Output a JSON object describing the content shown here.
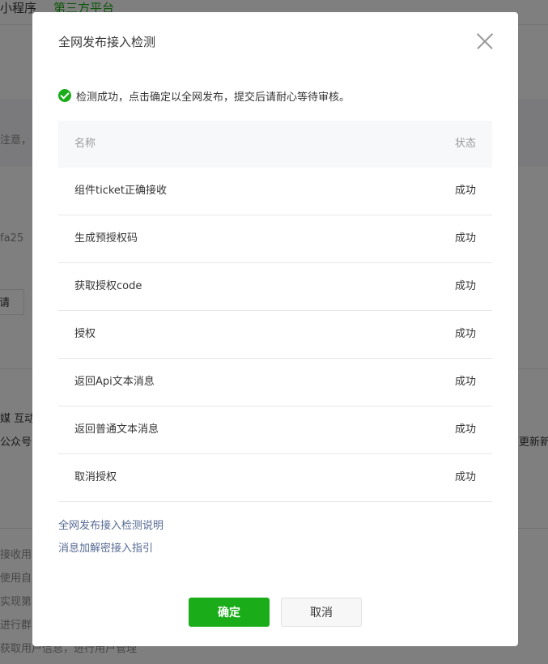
{
  "background": {
    "nav": [
      "小程序",
      "第三方平台"
    ],
    "texts": {
      "t1": "注意，",
      "t2": "fa25",
      "t3": "请",
      "t4": "媒 互动",
      "t5": "公众号",
      "t6": "更新新",
      "t7": "接收用",
      "t8": "使用自",
      "t9": "实现第",
      "t10": "进行群",
      "t11": "获取用户信息，进行用户管理"
    }
  },
  "dialog": {
    "title": "全网发布接入检测",
    "status_message": "检测成功，点击确定以全网发布，提交后请耐心等待审核。",
    "table": {
      "headers": {
        "name": "名称",
        "status": "状态"
      },
      "rows": [
        {
          "name": "组件ticket正确接收",
          "status": "成功"
        },
        {
          "name": "生成预授权码",
          "status": "成功"
        },
        {
          "name": "获取授权code",
          "status": "成功"
        },
        {
          "name": "授权",
          "status": "成功"
        },
        {
          "name": "返回Api文本消息",
          "status": "成功"
        },
        {
          "name": "返回普通文本消息",
          "status": "成功"
        },
        {
          "name": "取消授权",
          "status": "成功"
        }
      ]
    },
    "links": [
      "全网发布接入检测说明",
      "消息加解密接入指引"
    ],
    "buttons": {
      "confirm": "确定",
      "cancel": "取消"
    },
    "colors": {
      "primary": "#1aad19",
      "link": "#576b95",
      "text": "#353535",
      "muted": "#9a9a9a"
    }
  }
}
